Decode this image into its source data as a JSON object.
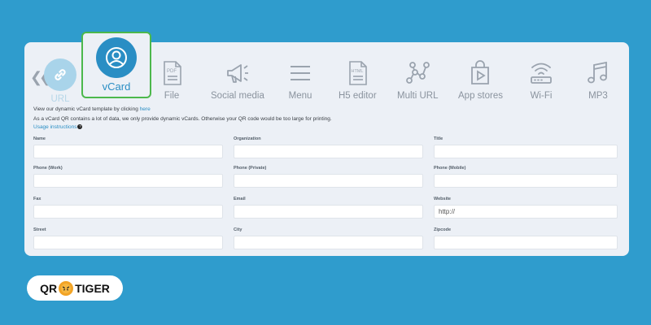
{
  "tabs": {
    "back_icon": "double-chevron-left-icon",
    "items": [
      {
        "label": "URL",
        "icon": "link-icon"
      },
      {
        "label": "vCard",
        "icon": "person-icon"
      },
      {
        "label": "File",
        "icon": "pdf-file-icon"
      },
      {
        "label": "Social media",
        "icon": "megaphone-icon"
      },
      {
        "label": "Menu",
        "icon": "hamburger-menu-icon"
      },
      {
        "label": "H5 editor",
        "icon": "html-file-icon"
      },
      {
        "label": "Multi URL",
        "icon": "nodes-icon"
      },
      {
        "label": "App stores",
        "icon": "shopping-bag-play-icon"
      },
      {
        "label": "Wi-Fi",
        "icon": "wifi-router-icon"
      },
      {
        "label": "MP3",
        "icon": "music-note-icon"
      }
    ]
  },
  "info": {
    "template_text": "View our dynamic vCard template by clicking",
    "template_link": "here",
    "note": "As a vCard QR contains a lot of data, we only provide dynamic vCards. Otherwise your QR code would be too large for printing.",
    "usage_link": "Usage instructions",
    "help_icon": "?"
  },
  "form": {
    "fields": [
      {
        "label": "Name",
        "value": ""
      },
      {
        "label": "Organization",
        "value": ""
      },
      {
        "label": "Title",
        "value": ""
      },
      {
        "label": "Phone (Work)",
        "value": ""
      },
      {
        "label": "Phone (Private)",
        "value": ""
      },
      {
        "label": "Phone (Mobile)",
        "value": ""
      },
      {
        "label": "Fax",
        "value": ""
      },
      {
        "label": "Email",
        "value": ""
      },
      {
        "label": "Website",
        "value": "http://"
      },
      {
        "label": "Street",
        "value": ""
      },
      {
        "label": "City",
        "value": ""
      },
      {
        "label": "Zipcode",
        "value": ""
      }
    ]
  },
  "brand": {
    "left": "QR",
    "right": "TIGER",
    "accent": "#f2a325"
  },
  "colors": {
    "background": "#2f9ccd",
    "accent": "#2a8ec4",
    "selected_border": "#4cb84c"
  }
}
